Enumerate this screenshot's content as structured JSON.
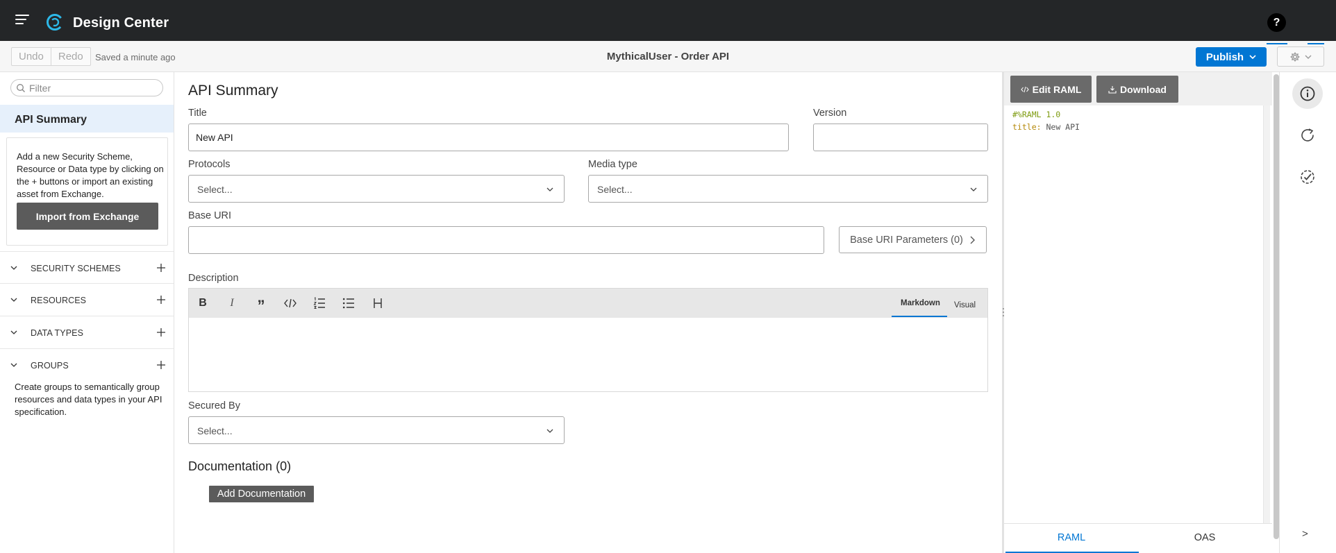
{
  "topbar": {
    "app_title": "Design Center",
    "help_label": "?"
  },
  "toolbar": {
    "undo_label": "Undo",
    "redo_label": "Redo",
    "saved_status": "Saved a minute ago",
    "project_title": "MythicalUser - Order API",
    "publish_label": "Publish"
  },
  "sidebar": {
    "filter_placeholder": "Filter",
    "summary_label": "API Summary",
    "info_text": "Add a new Security Scheme, Resource or Data type by clicking on the + buttons or import an existing asset from Exchange.",
    "import_label": "Import from Exchange",
    "sections": [
      {
        "label": "SECURITY SCHEMES"
      },
      {
        "label": "RESOURCES"
      },
      {
        "label": "DATA TYPES"
      },
      {
        "label": "GROUPS"
      }
    ],
    "groups_note": "Create groups to semantically group resources and data types in your API specification."
  },
  "main": {
    "heading": "API Summary",
    "title_label": "Title",
    "title_value": "New API",
    "version_label": "Version",
    "version_value": "",
    "protocols_label": "Protocols",
    "protocols_value": "Select...",
    "media_type_label": "Media type",
    "media_type_value": "Select...",
    "base_uri_label": "Base URI",
    "base_uri_value": "",
    "base_uri_params_label": "Base URI Parameters (0)",
    "description_label": "Description",
    "editor_modes": [
      "Markdown",
      "Visual"
    ],
    "active_mode": "Markdown",
    "secured_by_label": "Secured By",
    "secured_by_value": "Select...",
    "documentation_title": "Documentation (0)",
    "add_documentation_label": "Add Documentation"
  },
  "raml_panel": {
    "edit_label": "Edit RAML",
    "download_label": "Download",
    "code_lines": [
      {
        "keyword": "#%RAML 1.0",
        "value": ""
      },
      {
        "keyword": "title:",
        "value": "New API"
      }
    ],
    "tabs": [
      "RAML",
      "OAS"
    ],
    "active_tab": "RAML"
  },
  "icon_rail": {
    "items": [
      "info-icon",
      "share-icon",
      "validation-icon"
    ],
    "active": "info-icon",
    "collapse_label": ">"
  },
  "colors": {
    "topbar_bg": "#242628",
    "accent": "#0176d3",
    "dark_button": "#5b5b5b",
    "logo": "#2db8e8"
  }
}
